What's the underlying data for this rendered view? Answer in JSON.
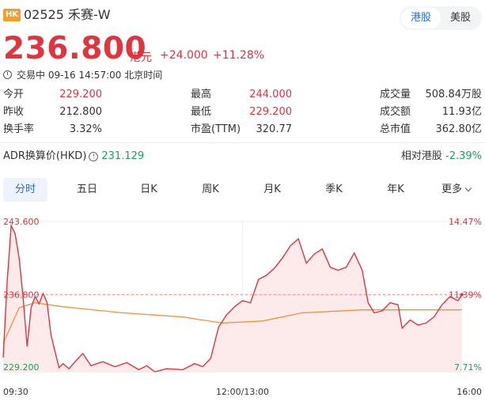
{
  "header": {
    "market_badge": "HK",
    "stock_name": "02525 禾赛-W",
    "market_tabs": [
      {
        "label": "港股",
        "active": true
      },
      {
        "label": "美股",
        "active": false
      }
    ]
  },
  "quote": {
    "price": "236.800",
    "currency": "港元",
    "change": "+24.000",
    "change_pct": "+11.28%",
    "status": "交易中 09-16 14:57:00 北京时间"
  },
  "stats": {
    "open": {
      "label": "今开",
      "value": "229.200"
    },
    "high": {
      "label": "最高",
      "value": "244.000"
    },
    "volume": {
      "label": "成交量",
      "value": "508.84万股"
    },
    "prev_close": {
      "label": "昨收",
      "value": "212.800"
    },
    "low": {
      "label": "最低",
      "value": "229.200"
    },
    "turnover": {
      "label": "成交额",
      "value": "11.93亿"
    },
    "turnover_rate": {
      "label": "换手率",
      "value": "3.32%"
    },
    "pe": {
      "label": "市盈(TTM)",
      "value": "320.77"
    },
    "market_cap": {
      "label": "总市值",
      "value": "362.80亿"
    }
  },
  "adr": {
    "label": "ADR换算价(HKD)",
    "value": "231.129",
    "relative_label": "相对港股",
    "relative_value": "-2.39%"
  },
  "tabs": [
    "分时",
    "五日",
    "日K",
    "周K",
    "月K",
    "季K",
    "年K",
    "更多"
  ],
  "chart_data": {
    "type": "line",
    "title": "",
    "y_labels_left": [
      "243.600",
      "236.800",
      "229.200"
    ],
    "y_labels_right": [
      "14.47%",
      "11.39%",
      "7.71%"
    ],
    "x_labels": [
      "09:30",
      "12:00/13:00",
      "16:00"
    ],
    "ylim": [
      229.2,
      244.0
    ],
    "reference_price": 236.8,
    "price_series": [
      {
        "t": 0,
        "v": 230.6
      },
      {
        "t": 2,
        "v": 238.0
      },
      {
        "t": 4,
        "v": 243.6
      },
      {
        "t": 6,
        "v": 242.8
      },
      {
        "t": 8,
        "v": 240.4
      },
      {
        "t": 10,
        "v": 236.5
      },
      {
        "t": 12,
        "v": 231.7
      },
      {
        "t": 14,
        "v": 235.5
      },
      {
        "t": 16,
        "v": 236.6
      },
      {
        "t": 18,
        "v": 235.9
      },
      {
        "t": 20,
        "v": 236.9
      },
      {
        "t": 22,
        "v": 236.0
      },
      {
        "t": 24,
        "v": 232.8
      },
      {
        "t": 26,
        "v": 231.2
      },
      {
        "t": 28,
        "v": 229.6
      },
      {
        "t": 30,
        "v": 230.0
      },
      {
        "t": 33,
        "v": 229.5
      },
      {
        "t": 36,
        "v": 230.2
      },
      {
        "t": 40,
        "v": 231.0
      },
      {
        "t": 44,
        "v": 229.8
      },
      {
        "t": 50,
        "v": 230.2
      },
      {
        "t": 56,
        "v": 229.7
      },
      {
        "t": 62,
        "v": 230.1
      },
      {
        "t": 68,
        "v": 229.4
      },
      {
        "t": 72,
        "v": 229.8
      },
      {
        "t": 76,
        "v": 229.2
      },
      {
        "t": 82,
        "v": 229.5
      },
      {
        "t": 90,
        "v": 229.4
      },
      {
        "t": 96,
        "v": 230.0
      },
      {
        "t": 100,
        "v": 229.7
      },
      {
        "t": 104,
        "v": 230.5
      },
      {
        "t": 108,
        "v": 233.6
      },
      {
        "t": 112,
        "v": 234.8
      },
      {
        "t": 116,
        "v": 235.6
      },
      {
        "t": 120,
        "v": 236.2
      },
      {
        "t": 124,
        "v": 236.0
      },
      {
        "t": 128,
        "v": 238.3
      },
      {
        "t": 132,
        "v": 238.7
      },
      {
        "t": 136,
        "v": 239.4
      },
      {
        "t": 140,
        "v": 240.4
      },
      {
        "t": 144,
        "v": 241.6
      },
      {
        "t": 148,
        "v": 242.3
      },
      {
        "t": 152,
        "v": 239.9
      },
      {
        "t": 156,
        "v": 240.8
      },
      {
        "t": 160,
        "v": 241.3
      },
      {
        "t": 164,
        "v": 239.5
      },
      {
        "t": 168,
        "v": 239.2
      },
      {
        "t": 172,
        "v": 239.5
      },
      {
        "t": 176,
        "v": 240.9
      },
      {
        "t": 180,
        "v": 239.2
      },
      {
        "t": 183,
        "v": 236.0
      },
      {
        "t": 186,
        "v": 235.0
      },
      {
        "t": 190,
        "v": 235.2
      },
      {
        "t": 194,
        "v": 236.0
      },
      {
        "t": 198,
        "v": 235.8
      },
      {
        "t": 200,
        "v": 233.5
      },
      {
        "t": 204,
        "v": 234.3
      },
      {
        "t": 208,
        "v": 233.8
      },
      {
        "t": 212,
        "v": 234.0
      },
      {
        "t": 216,
        "v": 234.6
      },
      {
        "t": 220,
        "v": 235.8
      },
      {
        "t": 224,
        "v": 236.6
      },
      {
        "t": 228,
        "v": 236.2
      },
      {
        "t": 230,
        "v": 236.8
      }
    ],
    "avg_series": [
      {
        "t": 0,
        "v": 232.0
      },
      {
        "t": 8,
        "v": 235.5
      },
      {
        "t": 16,
        "v": 236.0
      },
      {
        "t": 30,
        "v": 235.6
      },
      {
        "t": 60,
        "v": 235.0
      },
      {
        "t": 90,
        "v": 234.6
      },
      {
        "t": 110,
        "v": 234.0
      },
      {
        "t": 130,
        "v": 234.2
      },
      {
        "t": 150,
        "v": 235.0
      },
      {
        "t": 180,
        "v": 235.3
      },
      {
        "t": 230,
        "v": 235.3
      }
    ],
    "colors": {
      "price": "#e0343e",
      "avg": "#f0913a",
      "fill": "#fde8e8",
      "reference": "#f28c8c"
    }
  }
}
